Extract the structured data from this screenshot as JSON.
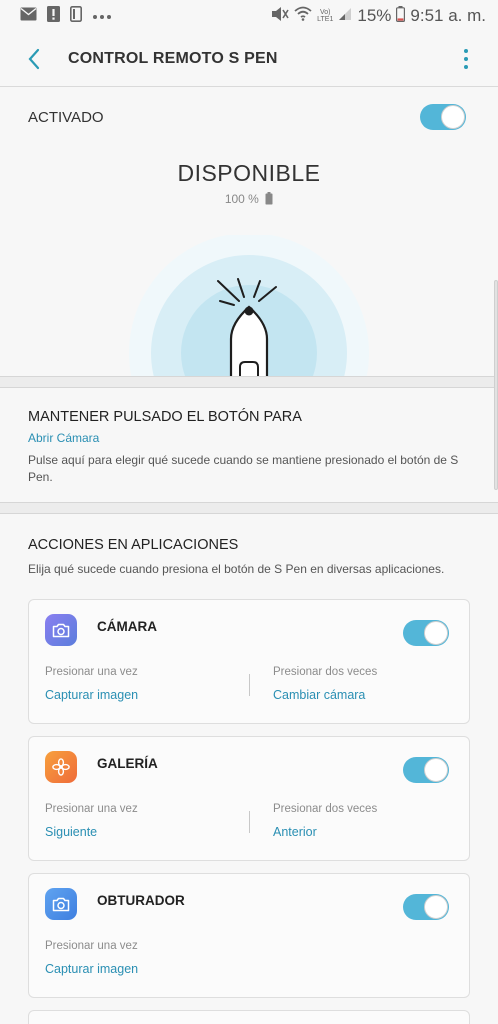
{
  "status_bar": {
    "battery_percent": "15%",
    "time": "9:51 a. m.",
    "network_top": "Vo)",
    "network_bottom": "LTE1"
  },
  "header": {
    "title": "CONTROL REMOTO S PEN"
  },
  "main_switch": {
    "label": "ACTIVADO",
    "on": true
  },
  "pen_status": {
    "state": "DISPONIBLE",
    "battery": "100 %"
  },
  "hold_button": {
    "title": "MANTENER PULSADO EL BOTÓN PARA",
    "value": "Abrir Cámara",
    "description": "Pulse aquí para elegir qué sucede cuando se mantiene presionado el botón de S Pen."
  },
  "app_actions": {
    "title": "ACCIONES EN APLICACIONES",
    "description": "Elija qué sucede cuando presiona el botón de S Pen en diversas aplicaciones.",
    "apps": [
      {
        "name": "CÁMARA",
        "icon": "camera-icon",
        "on": true,
        "single_label": "Presionar una vez",
        "single_value": "Capturar imagen",
        "double_label": "Presionar dos veces",
        "double_value": "Cambiar cámara"
      },
      {
        "name": "GALERÍA",
        "icon": "gallery-flower-icon",
        "on": true,
        "single_label": "Presionar una vez",
        "single_value": "Siguiente",
        "double_label": "Presionar dos veces",
        "double_value": "Anterior"
      },
      {
        "name": "OBTURADOR",
        "icon": "camera-icon",
        "on": true,
        "single_label": "Presionar una vez",
        "single_value": "Capturar imagen"
      }
    ]
  },
  "colors": {
    "accent": "#2a8fb3",
    "toggle_on": "#53b6d8",
    "camera_icon_bg": "#6d7be0",
    "gallery_icon_bg": "#f28a3a",
    "shutter_icon_bg": "#4a8fe6"
  }
}
